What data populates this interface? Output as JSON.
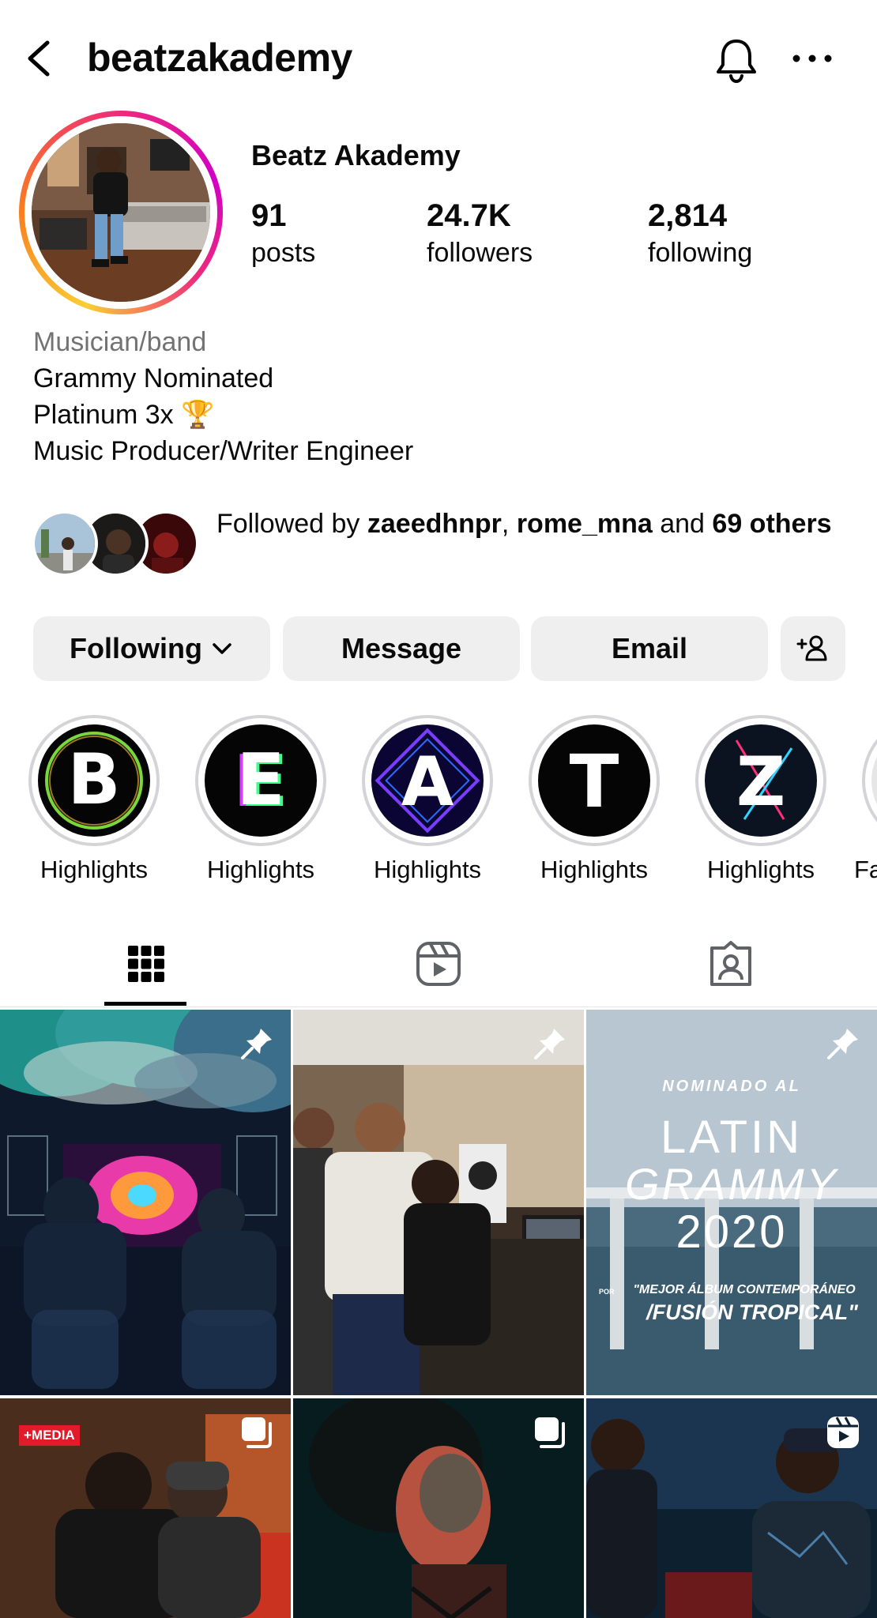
{
  "header": {
    "username": "beatzakademy"
  },
  "profile": {
    "display_name": "Beatz Akademy",
    "stats": {
      "posts": {
        "value": "91",
        "label": "posts"
      },
      "followers": {
        "value": "24.7K",
        "label": "followers"
      },
      "following": {
        "value": "2,814",
        "label": "following"
      }
    },
    "category": "Musician/band",
    "bio_lines": [
      "Grammy Nominated",
      "Platinum 3x 🏆",
      "Music Producer/Writer Engineer"
    ],
    "followed_by": {
      "prefix": "Followed by ",
      "user1": "zaeedhnpr",
      "separator": ", ",
      "user2": "rome_mna",
      "and_text": " and ",
      "others": "69 others"
    }
  },
  "actions": {
    "following_label": "Following",
    "message_label": "Message",
    "email_label": "Email"
  },
  "highlights": [
    {
      "label": "Highlights",
      "letter": "B"
    },
    {
      "label": "Highlights",
      "letter": "E"
    },
    {
      "label": "Highlights",
      "letter": "A"
    },
    {
      "label": "Highlights",
      "letter": "T"
    },
    {
      "label": "Highlights",
      "letter": "Z"
    },
    {
      "label": "Fa",
      "letter": ""
    }
  ],
  "tabs": [
    {
      "name": "grid",
      "icon": "grid-icon",
      "selected": true
    },
    {
      "name": "reels",
      "icon": "reels-icon",
      "selected": false
    },
    {
      "name": "tagged",
      "icon": "tagged-icon",
      "selected": false
    }
  ],
  "posts": {
    "post2_text": {
      "nominado": "NOMINADO AL",
      "latin": "LATIN",
      "grammy": "GRAMMY",
      "year": "2020",
      "por": "POR",
      "category1": "\"MEJOR ÁLBUM CONTEMPORÁNEO",
      "category2": "/FUSIÓN TROPICAL\""
    },
    "post3_tag": "+MEDIA"
  }
}
